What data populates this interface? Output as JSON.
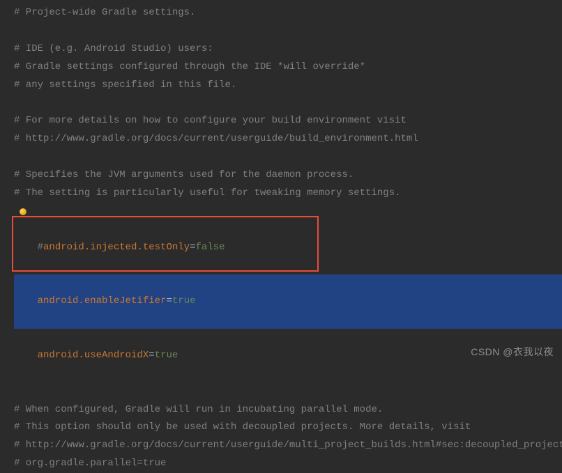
{
  "lines": {
    "l1": "# Project-wide Gradle settings.",
    "l2": "",
    "l3": "# IDE (e.g. Android Studio) users:",
    "l4": "# Gradle settings configured through the IDE *will override*",
    "l5": "# any settings specified in this file.",
    "l6": "",
    "l7": "# For more details on how to configure your build environment visit",
    "l8": "# http://www.gradle.org/docs/current/userguide/build_environment.html",
    "l9": "",
    "l10": "# Specifies the JVM arguments used for the daemon process.",
    "l11": "# The setting is particularly useful for tweaking memory settings.",
    "l12_key": "android.injected.testOnly",
    "l12_val": "false",
    "l13_key": "android.enableJetifier",
    "l13_val": "true",
    "l14_key": "android.useAndroidX",
    "l14_val": "true",
    "l15": "",
    "l16": "# When configured, Gradle will run in incubating parallel mode.",
    "l17": "# This option should only be used with decoupled projects. More details, visit",
    "l18": "# http://www.gradle.org/docs/current/userguide/multi_project_builds.html#sec:decoupled_projects",
    "l19": "# org.gradle.parallel=true"
  },
  "equals": "=",
  "hash_prefix": "#",
  "watermark": "CSDN @衣我以夜",
  "colors": {
    "background": "#2b2b2b",
    "comment": "#808080",
    "property": "#cc7832",
    "value": "#6a8759",
    "selection": "#214283",
    "highlight_border": "#e74c3c"
  }
}
